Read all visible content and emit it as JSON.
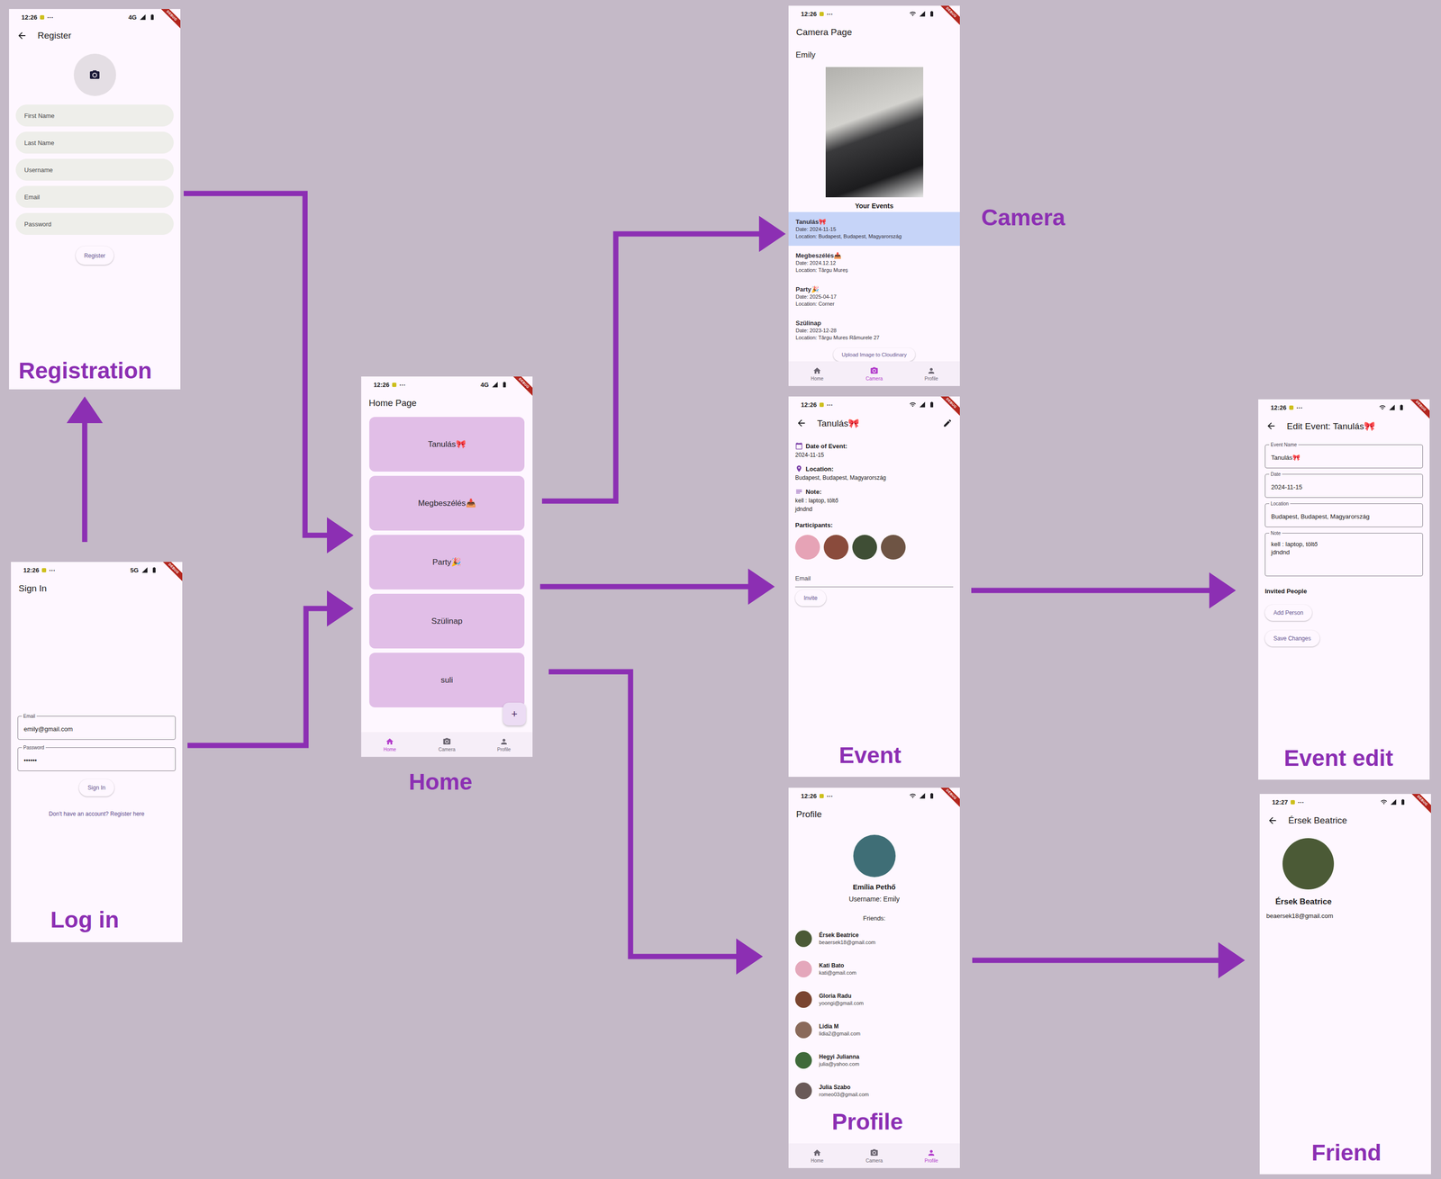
{
  "debug_banner": "DEBUG",
  "registration": {
    "caption": "Registration",
    "status": {
      "time": "12:26",
      "dots": "···",
      "network": "4G"
    },
    "title": "Register",
    "fields": [
      "First Name",
      "Last Name",
      "Username",
      "Email",
      "Password"
    ],
    "button": "Register"
  },
  "login": {
    "caption": "Log in",
    "status": {
      "time": "12:26",
      "dots": "···",
      "network": "5G"
    },
    "title": "Sign In",
    "fields": [
      {
        "label": "Email",
        "value": "emily@gmail.com"
      },
      {
        "label": "Password",
        "value": "••••••"
      }
    ],
    "button": "Sign In",
    "link": "Don't have an account? Register here"
  },
  "home": {
    "caption": "Home",
    "status": {
      "time": "12:26",
      "dots": "···",
      "network": "4G"
    },
    "title": "Home Page",
    "events": [
      "Tanulás🎀",
      "Megbeszélés📥",
      "Party🎉",
      "Szülinap",
      "suli"
    ],
    "fab": "+",
    "nav": [
      {
        "label": "Home",
        "selected": true
      },
      {
        "label": "Camera",
        "selected": false
      },
      {
        "label": "Profile",
        "selected": false
      }
    ]
  },
  "camera": {
    "caption": "Camera",
    "status": {
      "time": "12:26",
      "dots": "···"
    },
    "title": "Camera Page",
    "user": "Emily",
    "section": "Your Events",
    "events": [
      {
        "name": "Tanulás🎀",
        "date": "Date: 2024-11-15",
        "location": "Location: Budapest, Budapest, Magyarország",
        "selected": true
      },
      {
        "name": "Megbeszélés📥",
        "date": "Date: 2024.12.12",
        "location": "Location: Târgu Mureș",
        "selected": false
      },
      {
        "name": "Party🎉",
        "date": "Date: 2025-04-17",
        "location": "Location: Corner",
        "selected": false
      },
      {
        "name": "Szülinap",
        "date": "Date: 2023-12-28",
        "location": "Location: Târgu Mures Rămurele 27",
        "selected": false
      }
    ],
    "button": "Upload Image to Cloudinary",
    "nav": [
      {
        "label": "Home",
        "selected": false
      },
      {
        "label": "Camera",
        "selected": true
      },
      {
        "label": "Profile",
        "selected": false
      }
    ]
  },
  "event": {
    "caption": "Event",
    "status": {
      "time": "12:26",
      "dots": "···"
    },
    "title": "Tanulás🎀",
    "details": [
      {
        "kind": "date",
        "label": "Date of Event:",
        "lines": [
          "2024-11-15"
        ]
      },
      {
        "kind": "location",
        "label": "Location:",
        "lines": [
          "Budapest, Budapest, Magyarország"
        ]
      },
      {
        "kind": "note",
        "label": "Note:",
        "lines": [
          "kell : laptop, töltő",
          "jdndnd"
        ]
      }
    ],
    "participants_label": "Participants:",
    "participants": [
      {
        "color": "#e6a3b6"
      },
      {
        "color": "#8a4b3c"
      },
      {
        "color": "#3f4e35"
      },
      {
        "color": "#6e5444"
      }
    ],
    "email_label": "Email",
    "button": "Invite"
  },
  "event_edit": {
    "caption": "Event edit",
    "status": {
      "time": "12:26",
      "dots": "···"
    },
    "title": "Edit Event: Tanulás🎀",
    "fields": [
      {
        "label": "Event Name",
        "lines": [
          "Tanulás🎀"
        ]
      },
      {
        "label": "Date",
        "lines": [
          "2024-11-15"
        ]
      },
      {
        "label": "Location",
        "lines": [
          "Budapest, Budapest, Magyarország"
        ]
      },
      {
        "label": "Note",
        "lines": [
          "kell : laptop, töltő",
          "jdndnd"
        ]
      }
    ],
    "section": "Invited People",
    "buttons": [
      "Add Person",
      "Save Changes"
    ]
  },
  "profile": {
    "caption": "Profile",
    "status": {
      "time": "12:26",
      "dots": "···"
    },
    "title": "Profile",
    "avatar_color": "#3f6e76",
    "name": "Emília Pethő",
    "username": "Username: Emily",
    "friends_label": "Friends:",
    "friends": [
      {
        "name": "Érsek Beatrice",
        "email": "beaersek18@gmail.com",
        "color": "#4b5a36"
      },
      {
        "name": "Kati Bato",
        "email": "kati@gmail.com",
        "color": "#e4a7bb"
      },
      {
        "name": "Gloria Radu",
        "email": "yoongi@gmail.com",
        "color": "#7a4530"
      },
      {
        "name": "Lidia M",
        "email": "lidia2@gmail.com",
        "color": "#8a6a5a"
      },
      {
        "name": "Hegyi Julianna",
        "email": "julia@yahoo.com",
        "color": "#3f6a3a"
      },
      {
        "name": "Julia Szabo",
        "email": "romeo03@gmail.com",
        "color": "#6a5a58"
      }
    ],
    "nav": [
      {
        "label": "Home",
        "selected": false
      },
      {
        "label": "Camera",
        "selected": false
      },
      {
        "label": "Profile",
        "selected": true
      }
    ]
  },
  "friend": {
    "caption": "Friend",
    "status": {
      "time": "12:27",
      "dots": "···"
    },
    "title": "Érsek Beatrice",
    "avatar_color": "#4b5a36",
    "name": "Érsek Beatrice",
    "email": "beaersek18@gmail.com"
  }
}
